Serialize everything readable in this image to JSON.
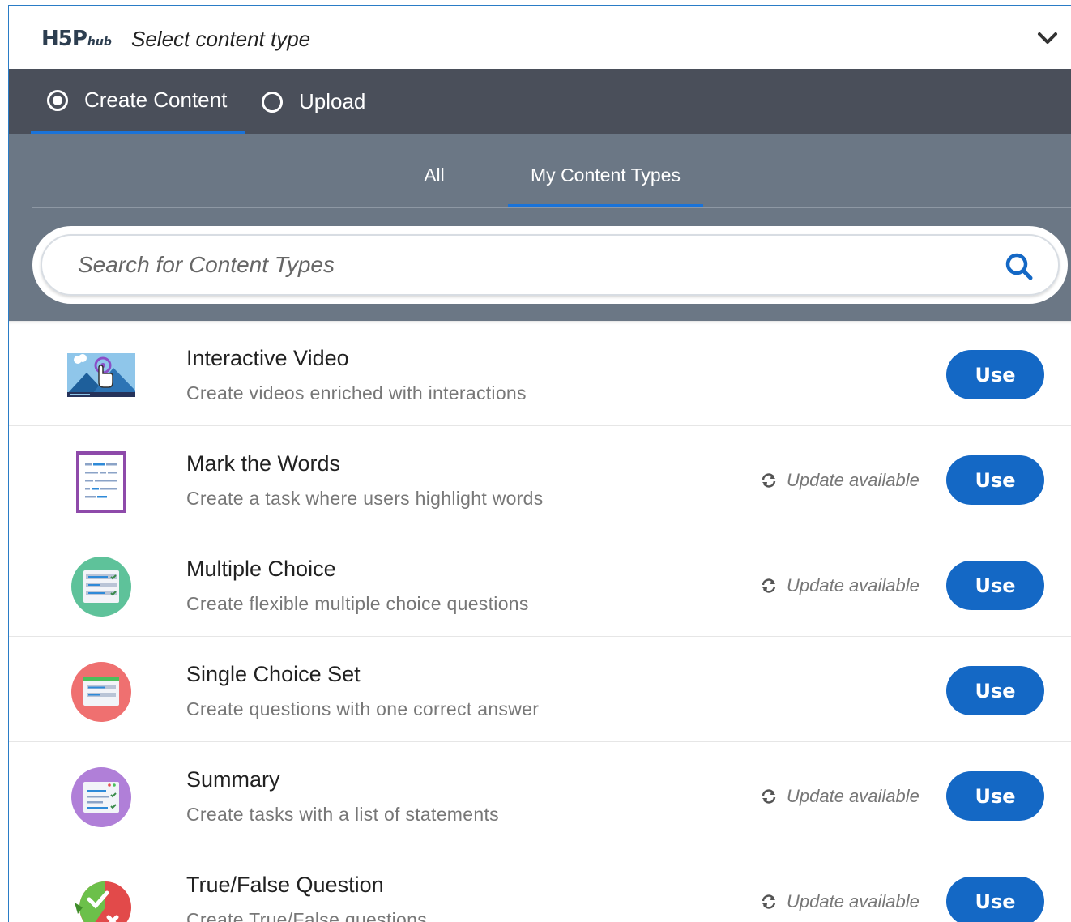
{
  "header": {
    "logo_main": "H5P",
    "logo_sub": "hub",
    "title": "Select content type"
  },
  "mode_tabs": [
    {
      "label": "Create Content",
      "selected": true
    },
    {
      "label": "Upload",
      "selected": false
    }
  ],
  "filter_tabs": [
    {
      "label": "All",
      "active": false
    },
    {
      "label": "My Content Types",
      "active": true
    }
  ],
  "search": {
    "placeholder": "Search for Content Types",
    "value": ""
  },
  "items": [
    {
      "title": "Interactive Video",
      "description": "Create videos enriched with interactions",
      "update": "",
      "button": "Use",
      "icon": "interactive-video-icon"
    },
    {
      "title": "Mark the Words",
      "description": "Create a task where users highlight words",
      "update": "Update available",
      "button": "Use",
      "icon": "mark-the-words-icon"
    },
    {
      "title": "Multiple Choice",
      "description": "Create flexible multiple choice questions",
      "update": "Update available",
      "button": "Use",
      "icon": "multiple-choice-icon"
    },
    {
      "title": "Single Choice Set",
      "description": "Create questions with one correct answer",
      "update": "",
      "button": "Use",
      "icon": "single-choice-set-icon"
    },
    {
      "title": "Summary",
      "description": "Create tasks with a list of statements",
      "update": "Update available",
      "button": "Use",
      "icon": "summary-icon"
    },
    {
      "title": "True/False Question",
      "description": "Create True/False questions",
      "update": "Update available",
      "button": "Use",
      "icon": "true-false-icon"
    }
  ],
  "colors": {
    "accent": "#1468c5",
    "mode_bar": "#4a4f5a",
    "filter_area": "#6b7785"
  }
}
